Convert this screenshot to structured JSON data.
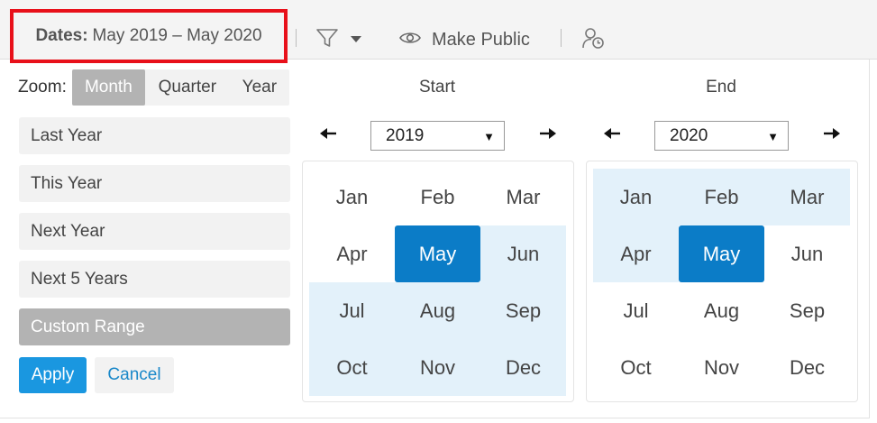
{
  "toolbar": {
    "dates_label": "Dates:",
    "dates_value": "May 2019 – May 2020",
    "make_public": "Make Public",
    "icons": [
      "filter-icon",
      "dropdown-caret-icon",
      "eye-icon",
      "user-clock-icon"
    ]
  },
  "zoom": {
    "label": "Zoom:",
    "options": [
      "Month",
      "Quarter",
      "Year"
    ],
    "selected": "Month"
  },
  "presets": [
    "Last Year",
    "This Year",
    "Next Year",
    "Next 5 Years",
    "Custom Range"
  ],
  "active_preset": "Custom Range",
  "actions": {
    "apply": "Apply",
    "cancel": "Cancel"
  },
  "start": {
    "title": "Start",
    "year": "2019",
    "months": [
      "Jan",
      "Feb",
      "Mar",
      "Apr",
      "May",
      "Jun",
      "Jul",
      "Aug",
      "Sep",
      "Oct",
      "Nov",
      "Dec"
    ],
    "selected_month": "May"
  },
  "end": {
    "title": "End",
    "year": "2020",
    "months": [
      "Jan",
      "Feb",
      "Mar",
      "Apr",
      "May",
      "Jun",
      "Jul",
      "Aug",
      "Sep",
      "Oct",
      "Nov",
      "Dec"
    ],
    "selected_month": "May"
  },
  "colors": {
    "highlight_border": "#e8101a",
    "selected_month": "#0b7cc7",
    "range_fill": "#e3f1fa",
    "apply_button": "#1a97e0",
    "active_segment": "#b3b3b3"
  }
}
